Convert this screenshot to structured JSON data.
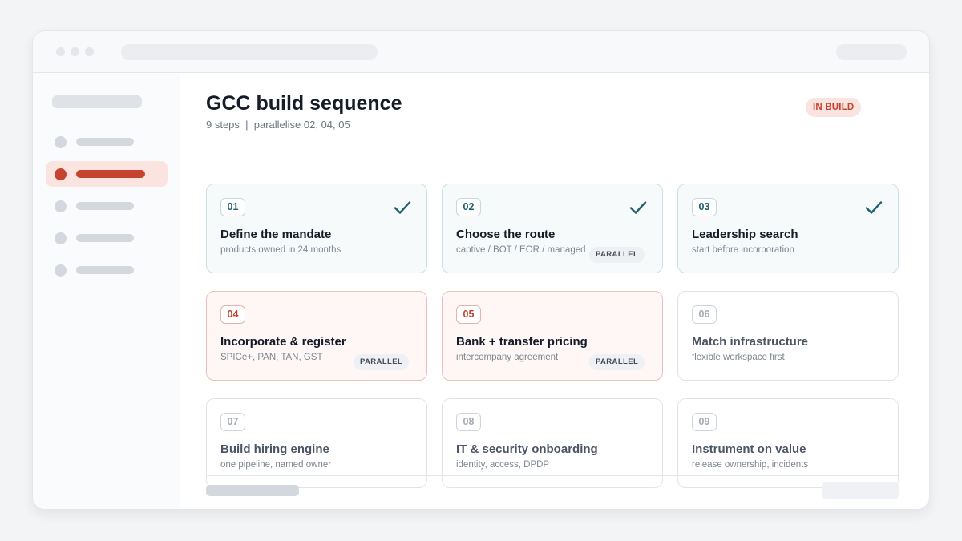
{
  "header": {
    "title": "GCC build sequence",
    "subtitle": "9 steps  |  parallelise 02, 04, 05",
    "status": "IN BUILD"
  },
  "colors": {
    "accent": "#c6432f",
    "done": "#1f5f6e"
  },
  "icons": {
    "done": "check-icon"
  },
  "steps": [
    {
      "num": "01",
      "title": "Define the mandate",
      "desc": "products owned in 24 months",
      "state": "done",
      "parallel": ""
    },
    {
      "num": "02",
      "title": "Choose the route",
      "desc": "captive / BOT / EOR / managed",
      "state": "done",
      "parallel": "PARALLEL"
    },
    {
      "num": "03",
      "title": "Leadership search",
      "desc": "start before incorporation",
      "state": "done",
      "parallel": ""
    },
    {
      "num": "04",
      "title": "Incorporate & register",
      "desc": "SPICe+, PAN, TAN, GST",
      "state": "active",
      "parallel": "PARALLEL"
    },
    {
      "num": "05",
      "title": "Bank + transfer pricing",
      "desc": "intercompany agreement",
      "state": "active",
      "parallel": "PARALLEL"
    },
    {
      "num": "06",
      "title": "Match infrastructure",
      "desc": "flexible workspace first",
      "state": "pending",
      "parallel": ""
    },
    {
      "num": "07",
      "title": "Build hiring engine",
      "desc": "one pipeline, named owner",
      "state": "pending",
      "parallel": ""
    },
    {
      "num": "08",
      "title": "IT & security onboarding",
      "desc": "identity, access, DPDP",
      "state": "pending",
      "parallel": ""
    },
    {
      "num": "09",
      "title": "Instrument on value",
      "desc": "release ownership, incidents",
      "state": "pending",
      "parallel": ""
    }
  ]
}
